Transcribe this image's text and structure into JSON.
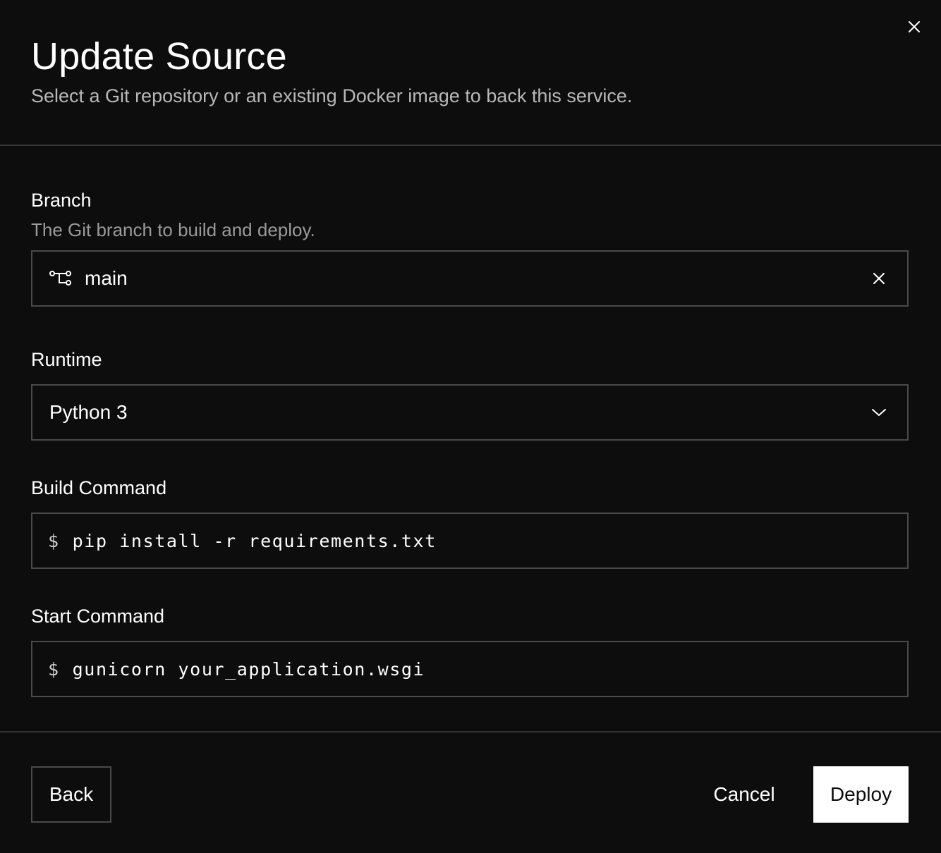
{
  "dialog": {
    "title": "Update Source",
    "subtitle": "Select a Git repository or an existing Docker image to back this service."
  },
  "branch": {
    "label": "Branch",
    "helper": "The Git branch to build and deploy.",
    "value": "main",
    "icon": "git-branch-icon"
  },
  "runtime": {
    "label": "Runtime",
    "value": "Python 3"
  },
  "build_command": {
    "label": "Build Command",
    "prompt": "$",
    "value": "pip install -r requirements.txt"
  },
  "start_command": {
    "label": "Start Command",
    "prompt": "$",
    "value": "gunicorn your_application.wsgi"
  },
  "footer": {
    "back_label": "Back",
    "cancel_label": "Cancel",
    "deploy_label": "Deploy"
  },
  "colors": {
    "background": "#0d0d0d",
    "border": "#4a4a4a",
    "divider": "#333333",
    "primary_button": "#ffffff"
  }
}
